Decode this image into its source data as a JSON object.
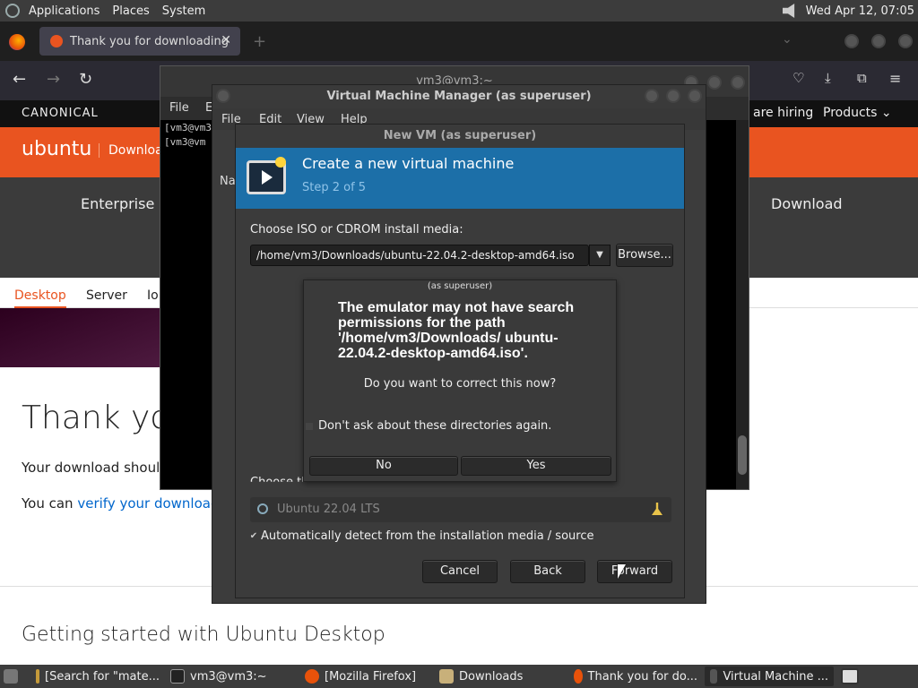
{
  "top_panel": {
    "menus": [
      "Applications",
      "Places",
      "System"
    ],
    "datetime": "Wed Apr 12, 07:05"
  },
  "firefox": {
    "tab_title": "Thank you for downloading",
    "new_tab": "+"
  },
  "webpage": {
    "canonical": "CANONICAL",
    "hiring": "are hiring",
    "products": "Products",
    "ubuntu": "ubuntu",
    "downloads": "Downloa",
    "nav_enterprise": "Enterprise",
    "nav_download": "Download",
    "subnav_desktop": "Desktop",
    "subnav_server": "Server",
    "subnav_io": "Io",
    "thankyou": "Thank you",
    "download_should": "Your download shoul",
    "you_can": "You can",
    "verify_link": "verify your download",
    "getting_started": "Getting started with Ubuntu Desktop"
  },
  "terminal": {
    "title": "vm3@vm3:~",
    "menus": [
      "File",
      "E"
    ],
    "lines": [
      "[vm3@vm3",
      "[vm3@vm"
    ]
  },
  "vmm": {
    "title": "Virtual Machine Manager (as superuser)",
    "menus": [
      "File",
      "Edit",
      "View",
      "Help"
    ],
    "col_name": "Na"
  },
  "newvm": {
    "title": "New VM (as superuser)",
    "heading": "Create a new virtual machine",
    "step": "Step 2 of 5",
    "choose_iso": "Choose ISO or CDROM install media:",
    "iso_path": "/home/vm3/Downloads/ubuntu-22.04.2-desktop-amd64.iso",
    "browse": "Browse...",
    "choose_os": "Choose the operating system you are installing:",
    "os_value": "Ubuntu 22.04 LTS",
    "auto_detect": "Automatically detect from the installation media / source",
    "auto_detect_checked": true,
    "cancel": "Cancel",
    "back": "Back",
    "forward": "Forward"
  },
  "alert": {
    "title": "(as superuser)",
    "primary": "The emulator may not have search permissions for the path '/home/vm3/Downloads/ ubuntu-22.04.2-desktop-amd64.iso'.",
    "secondary": "Do you want to correct this now?",
    "dont_ask": "Don't ask about these directories again.",
    "no": "No",
    "yes": "Yes"
  },
  "taskbar": {
    "items": [
      "[Search for \"mate...",
      "vm3@vm3:~",
      "[Mozilla Firefox]",
      "Downloads",
      "Thank you for do...",
      "Virtual Machine ..."
    ]
  }
}
